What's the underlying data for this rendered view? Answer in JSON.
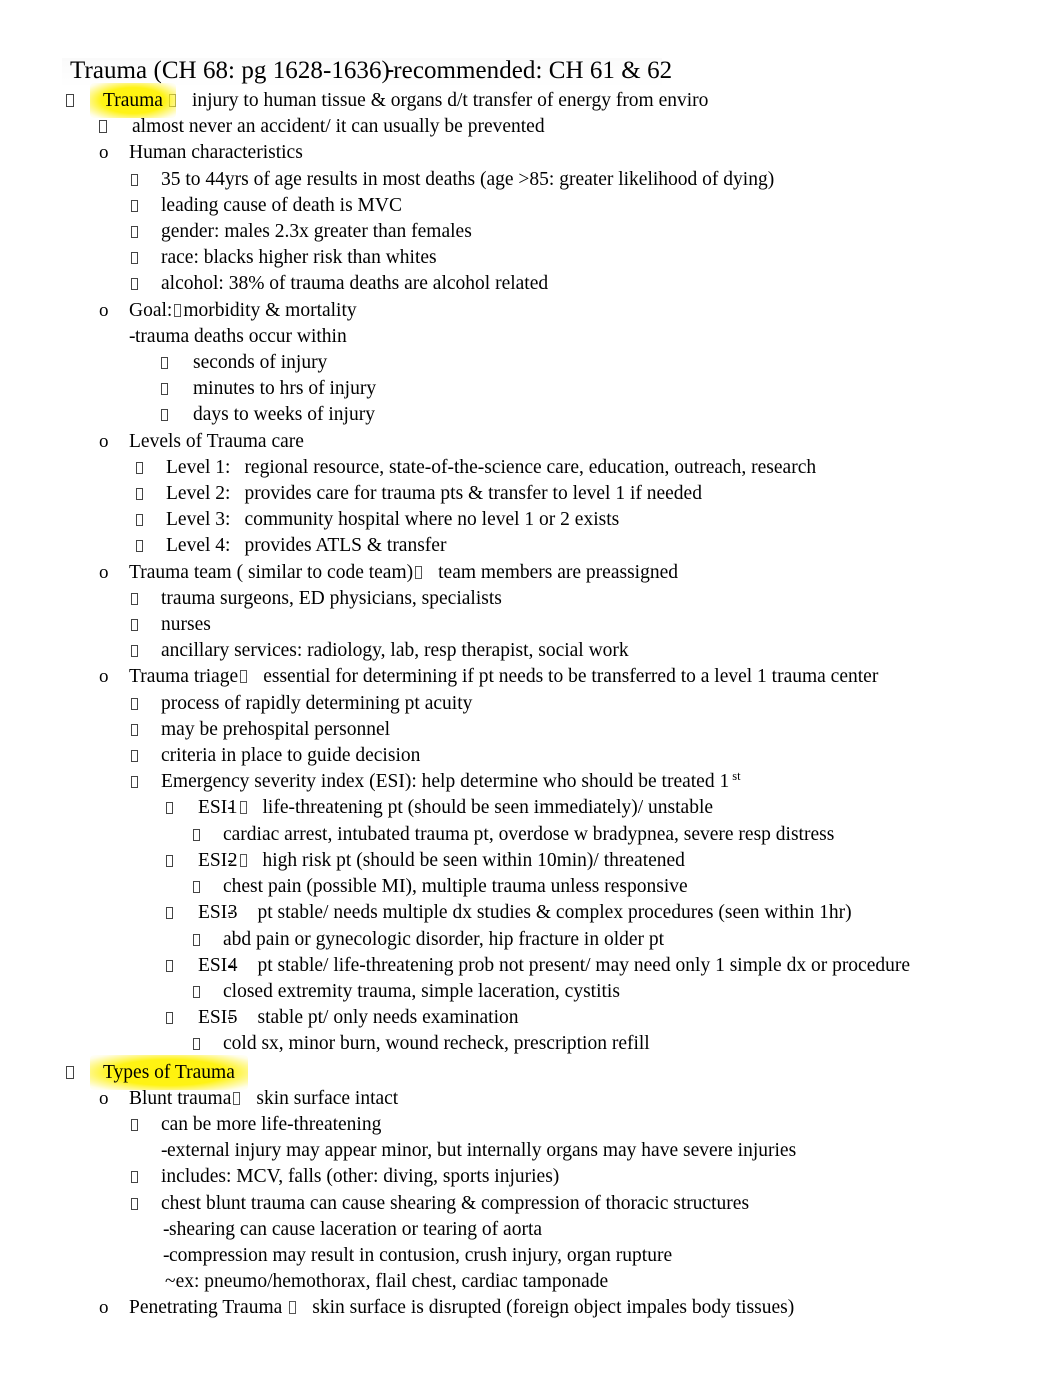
{
  "document": {
    "title_main": "Trauma (CH 68: pg 1628-1636)",
    "title_dash": "-",
    "title_rest": "recommended: CH 61 & 62",
    "highlight_color": "#fff200"
  },
  "outline": {
    "trauma_heading": "Trauma",
    "trauma_def": "injury to human tissue & organs d/t transfer of energy from enviro",
    "trauma_note": "almost never an accident/ it can usually be prevented",
    "human_characteristics_label": "Human characteristics",
    "human_characteristics": [
      "35 to 44yrs of age results in most deaths (age >85: greater likelihood of dying)",
      "leading cause of death is MVC",
      "gender: males 2.3x greater than females",
      "race: blacks higher risk than whites",
      "alcohol: 38% of trauma deaths are alcohol related"
    ],
    "goal_label": "Goal:",
    "goal_value": "morbidity & mortality",
    "trauma_deaths_dash": "-",
    "trauma_deaths_label": "trauma deaths occur within",
    "trauma_deaths_times": [
      "seconds of injury",
      "minutes to hrs of injury",
      "days to weeks of injury"
    ],
    "levels_label": "Levels of Trauma care",
    "levels": [
      {
        "label": "Level 1:",
        "desc": "regional resource, state-of-the-science care, education, outreach, research"
      },
      {
        "label": "Level 2:",
        "desc": "provides care for trauma pts & transfer to level 1 if needed"
      },
      {
        "label": "Level 3:",
        "desc": "community hospital where no level 1 or 2 exists"
      },
      {
        "label": "Level 4:",
        "desc": "provides ATLS & transfer"
      }
    ],
    "team_label": "Trauma team ( similar to code team)",
    "team_value": "team members are preassigned",
    "team_members": [
      "trauma surgeons, ED physicians, specialists",
      "nurses",
      "ancillary services: radiology, lab, resp therapist, social work"
    ],
    "triage_label": "Trauma triage",
    "triage_value": "essential for determining if pt needs to be transferred to a level 1 trauma center",
    "triage_points": [
      "process of rapidly determining pt acuity",
      "may be prehospital personnel",
      "criteria in place to guide decision"
    ],
    "esi_intro_a": "Emergency severity index (ESI): help determine who should be treated 1",
    "esi_intro_sup": "st",
    "esi": [
      {
        "label_a": "ESI-",
        "label_b": "1",
        "desc": "life-threatening pt (should be seen immediately)/ unstable",
        "example": "cardiac arrest, intubated trauma pt, overdose w bradypnea, severe resp distress"
      },
      {
        "label_a": "ESI-",
        "label_b": "2",
        "desc": "high risk pt (should be seen within 10min)/ threatened",
        "example": "chest pain (possible MI), multiple trauma unless responsive"
      },
      {
        "label_a": "ESI-",
        "label_b": "3",
        "desc": "pt stable/ needs multiple dx studies & complex procedures (seen within 1hr)",
        "example": "abd pain or gynecologic disorder, hip fracture in older pt"
      },
      {
        "label_a": "ESI-",
        "label_b": "4",
        "desc": "pt stable/ life-threatening prob not present/ may need only 1 simple dx or procedure",
        "example": "closed extremity trauma, simple laceration, cystitis"
      },
      {
        "label_a": "ESI-",
        "label_b": "5",
        "desc": "stable pt/ only needs examination",
        "example": "cold sx, minor burn, wound recheck, prescription refill"
      }
    ],
    "types_heading": "Types of Trauma",
    "blunt_label": "Blunt trauma",
    "blunt_value": "skin surface intact",
    "blunt_point1": "can be more life-threatening",
    "blunt_sub1_dash": "-",
    "blunt_sub1": "external injury may appear minor, but internally organs may have severe injuries",
    "blunt_point2": "includes: MCV, falls (other: diving, sports injuries)",
    "blunt_point3": "chest blunt trauma can cause shearing & compression of thoracic structures",
    "blunt_sub2_dash": "-",
    "blunt_sub2": "shearing can cause laceration or tearing of aorta",
    "blunt_sub3_dash": "-",
    "blunt_sub3": "compression may result in contusion, crush injury, organ rupture",
    "blunt_sub4_dash": "~",
    "blunt_sub4": "ex: pneumo/hemothorax, flail chest, cardiac tamponade",
    "penetrating_label": "Penetrating Trauma",
    "penetrating_value": "skin surface is disrupted (foreign object impales body tissues)"
  }
}
